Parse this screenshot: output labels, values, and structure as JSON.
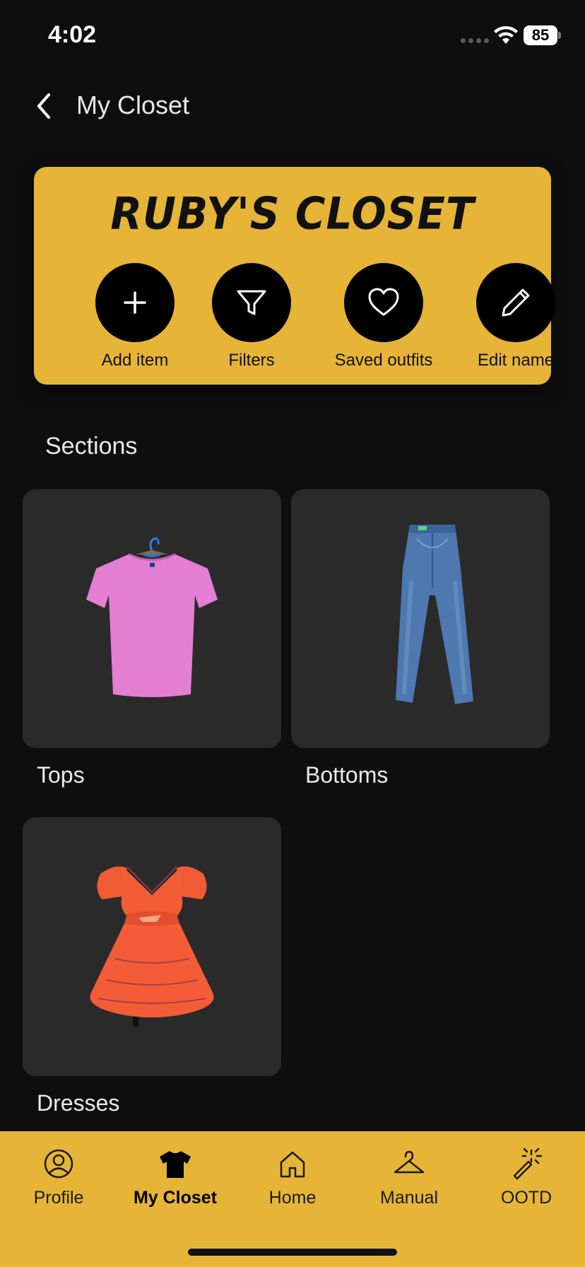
{
  "status_bar": {
    "time": "4:02",
    "battery": "85"
  },
  "header": {
    "title": "My Closet"
  },
  "closet_card": {
    "title": "RUBY'S CLOSET",
    "actions": [
      {
        "label": "Add item",
        "icon": "plus-icon"
      },
      {
        "label": "Filters",
        "icon": "filter-icon"
      },
      {
        "label": "Saved outfits",
        "icon": "heart-icon"
      },
      {
        "label": "Edit name",
        "icon": "pencil-icon"
      }
    ]
  },
  "sections": {
    "title": "Sections",
    "items": [
      {
        "label": "Tops",
        "image": "pink-tshirt-on-hanger"
      },
      {
        "label": "Bottoms",
        "image": "blue-jeans"
      },
      {
        "label": "Dresses",
        "image": "red-orange-dress"
      }
    ]
  },
  "bottom_nav": {
    "items": [
      {
        "label": "Profile",
        "icon": "profile-icon",
        "active": false
      },
      {
        "label": "My Closet",
        "icon": "tshirt-icon",
        "active": true
      },
      {
        "label": "Home",
        "icon": "home-icon",
        "active": false
      },
      {
        "label": "Manual",
        "icon": "hanger-icon",
        "active": false
      },
      {
        "label": "OOTD",
        "icon": "magic-wand-icon",
        "active": false
      }
    ]
  },
  "colors": {
    "accent": "#e6b537",
    "background": "#0e0e0f",
    "tile": "#2a2a2b"
  }
}
